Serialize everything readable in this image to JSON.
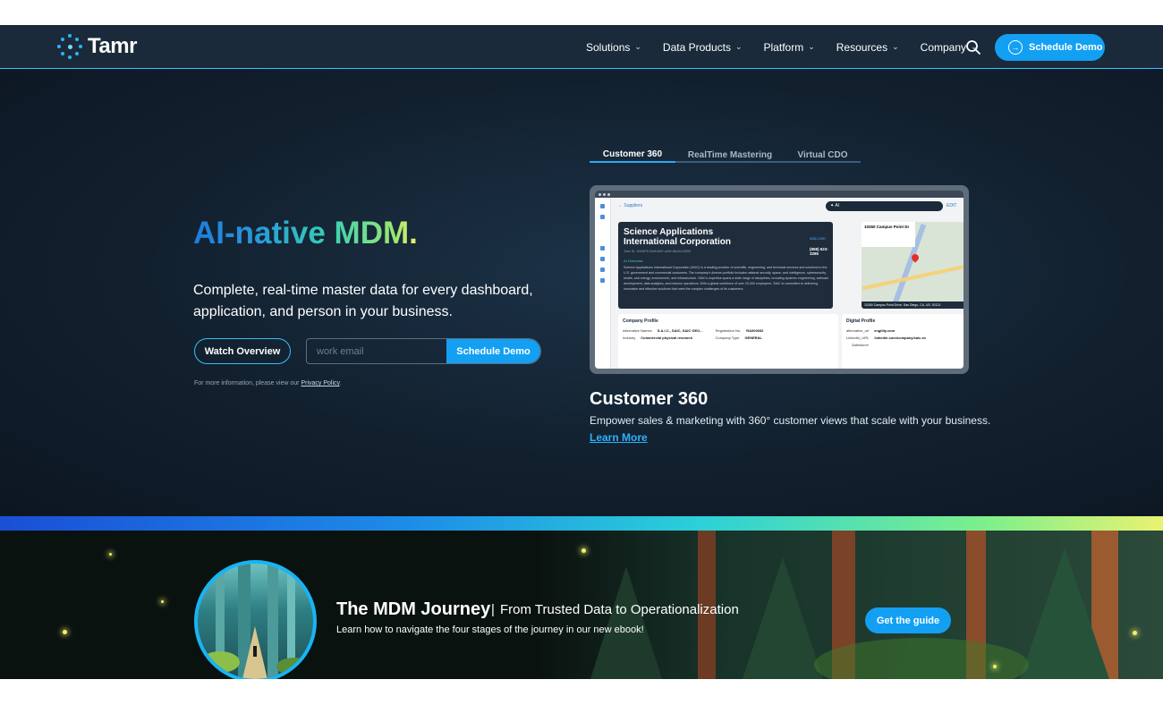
{
  "nav": {
    "logo_text": "Tamr",
    "menu": [
      {
        "label": "Solutions"
      },
      {
        "label": "Data Products"
      },
      {
        "label": "Platform"
      },
      {
        "label": "Resources"
      },
      {
        "label": "Company"
      }
    ],
    "cta_label": "Schedule Demo",
    "search_icon": "search-icon"
  },
  "hero": {
    "title": "AI-native MDM.",
    "subtitle": "Complete, real-time master data for every dashboard, application, and person in your business.",
    "watch_label": "Watch Overview",
    "email_placeholder": "work email",
    "email_cta": "Schedule Demo",
    "privacy_prefix": "For more information, please view our",
    "privacy_link": "Privacy Policy",
    "privacy_suffix": "."
  },
  "tabs": [
    {
      "label": "Customer 360",
      "active": true
    },
    {
      "label": "RealTime Mastering",
      "active": false
    },
    {
      "label": "Virtual CDO",
      "active": false
    }
  ],
  "screenshot": {
    "crumb": "Suppliers",
    "search_value": "AI",
    "edit_label": "EDIT",
    "company_name": "Science Applications International Corporation",
    "company_id": "Tamr ID: 1f449f78-00a9-8fd7-a49e-f8c2a112899",
    "ai_overview": "AI Overview",
    "description": "Science Applications International Corporation (SAIC) is a leading provider of scientific, engineering, and technical services and solutions to the U.S. government and commercial customers. The company's diverse portfolio includes national security, space, and intelligence, cybersecurity, health, and energy, environment, and infrastructure. SAIC's expertise spans a wide range of disciplines, including systems engineering, software development, data analytics, and mission operations. With a global workforce of over 23,000 employees, SAIC is committed to delivering innovative and effective solutions that meet the complex challenges of its customers.",
    "website": "saic.com",
    "phone": "(858) 623-3285",
    "map_address": "10260 Campus Point Dr",
    "map_footer": "10260 Campus Point Drive, San Diego, CA, US, 92121",
    "company_profile_title": "Company Profile",
    "digital_profile_title": "Digital Profile",
    "profile_rows": [
      {
        "k": "Alternative Names",
        "v": "S.A.I.C., SAIC, SAIC GEO..."
      },
      {
        "k": "Industry",
        "v": "Commercial physical research"
      },
      {
        "k": "Registration No.",
        "v": "RA000652"
      },
      {
        "k": "Company Type",
        "v": "GENERAL"
      }
    ],
    "digital_rows": [
      {
        "k": "alternative_url",
        "v": "engility.com"
      },
      {
        "k": "LinkedIn_URL",
        "v": "linkedin.com/company/saic-ec"
      },
      {
        "k": "",
        "v": "Salesforce"
      }
    ]
  },
  "feature": {
    "title": "Customer 360",
    "description": "Empower sales & marketing with 360° customer views that scale with your business.",
    "link": "Learn More"
  },
  "banner": {
    "title": "The MDM Journey",
    "separator": "|",
    "subtitle": "From Trusted Data to Operationalization",
    "description": "Learn how to navigate the four stages of the journey in our new ebook!",
    "cta": "Get the guide"
  },
  "colors": {
    "accent": "#13a0f3",
    "nav_bg": "#1a2a3a",
    "hero_bg": "#12202e"
  }
}
